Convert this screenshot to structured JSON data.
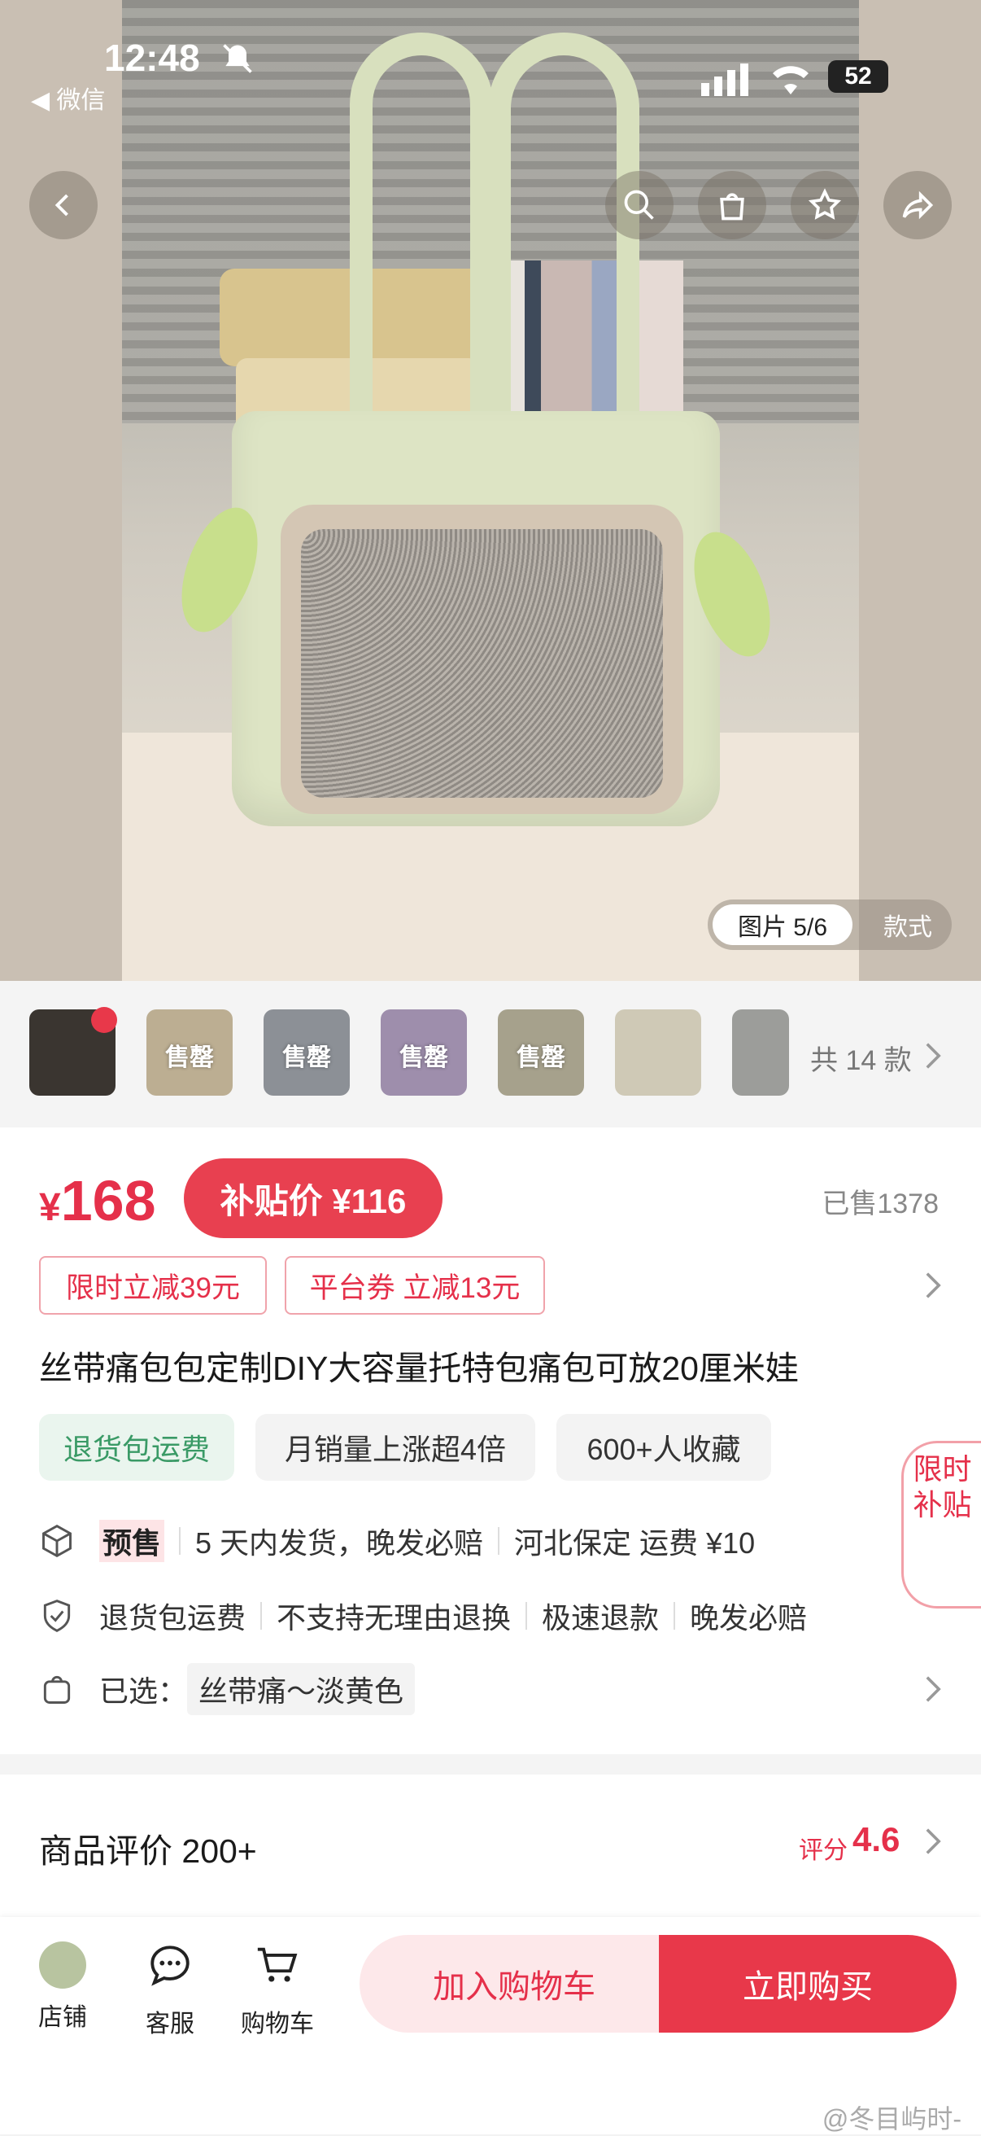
{
  "status_bar": {
    "time": "12:48",
    "back_app": "◀ 微信",
    "battery": "52"
  },
  "gallery": {
    "indicator": "图片 5/6",
    "style_tab": "款式"
  },
  "thumbs": {
    "labels": [
      "",
      "售罄",
      "售罄",
      "售罄",
      "售罄",
      "",
      ""
    ],
    "count": "共 14 款"
  },
  "price": {
    "currency": "¥",
    "value": "168",
    "subsidy_label": "补贴价 ¥116",
    "sold": "已售1378"
  },
  "coupons": [
    "限时立减39元",
    "平台券 立减13元"
  ],
  "product_title": "丝带痛包包定制DIY大容量托特包痛包可放20厘米娃",
  "pills": [
    "退货包运费",
    "月销量上涨超4倍",
    "600+人收藏"
  ],
  "shipping": {
    "presale": "预售",
    "items": [
      "5 天内发货，晚发必赔",
      "河北保定 运费 ¥10"
    ]
  },
  "guarantee": [
    "退货包运费",
    "不支持无理由退换",
    "极速退款",
    "晚发必赔"
  ],
  "selected": {
    "label": "已选：",
    "value": "丝带痛～淡黄色"
  },
  "side_tag": "限时补贴",
  "review": {
    "title": "商品评价 200+",
    "score_label": "评分",
    "score": "4.6"
  },
  "bottom_nav": {
    "shop": "店铺",
    "service": "客服",
    "cart": "购物车"
  },
  "actions": {
    "add_cart": "加入购物车",
    "buy_now": "立即购买"
  },
  "watermark": "@冬目屿时-",
  "colors": {
    "accent": "#e5304a",
    "green": "#3a9a66"
  }
}
